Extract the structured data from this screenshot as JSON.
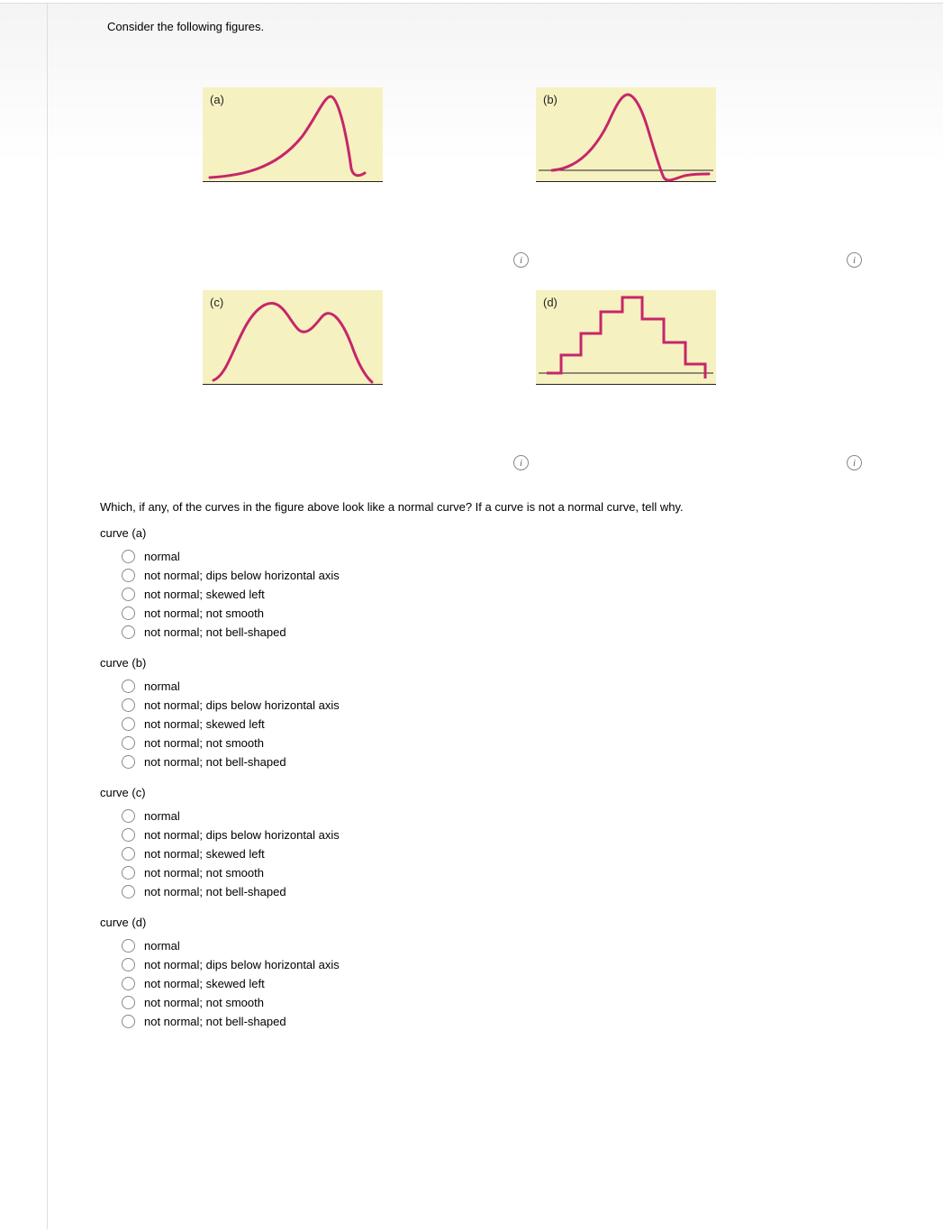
{
  "intro": "Consider the following figures.",
  "figures": {
    "a": {
      "label": "(a)"
    },
    "b": {
      "label": "(b)"
    },
    "c": {
      "label": "(c)"
    },
    "d": {
      "label": "(d)"
    }
  },
  "info_glyph": "i",
  "question": "Which, if any, of the curves in the figure above look like a normal curve? If a curve is not a normal curve, tell why.",
  "options": [
    "normal",
    "not normal; dips below horizontal axis",
    "not normal; skewed left",
    "not normal; not smooth",
    "not normal; not bell-shaped"
  ],
  "curves": {
    "a": {
      "title": "curve (a)"
    },
    "b": {
      "title": "curve (b)"
    },
    "c": {
      "title": "curve (c)"
    },
    "d": {
      "title": "curve (d)"
    }
  }
}
